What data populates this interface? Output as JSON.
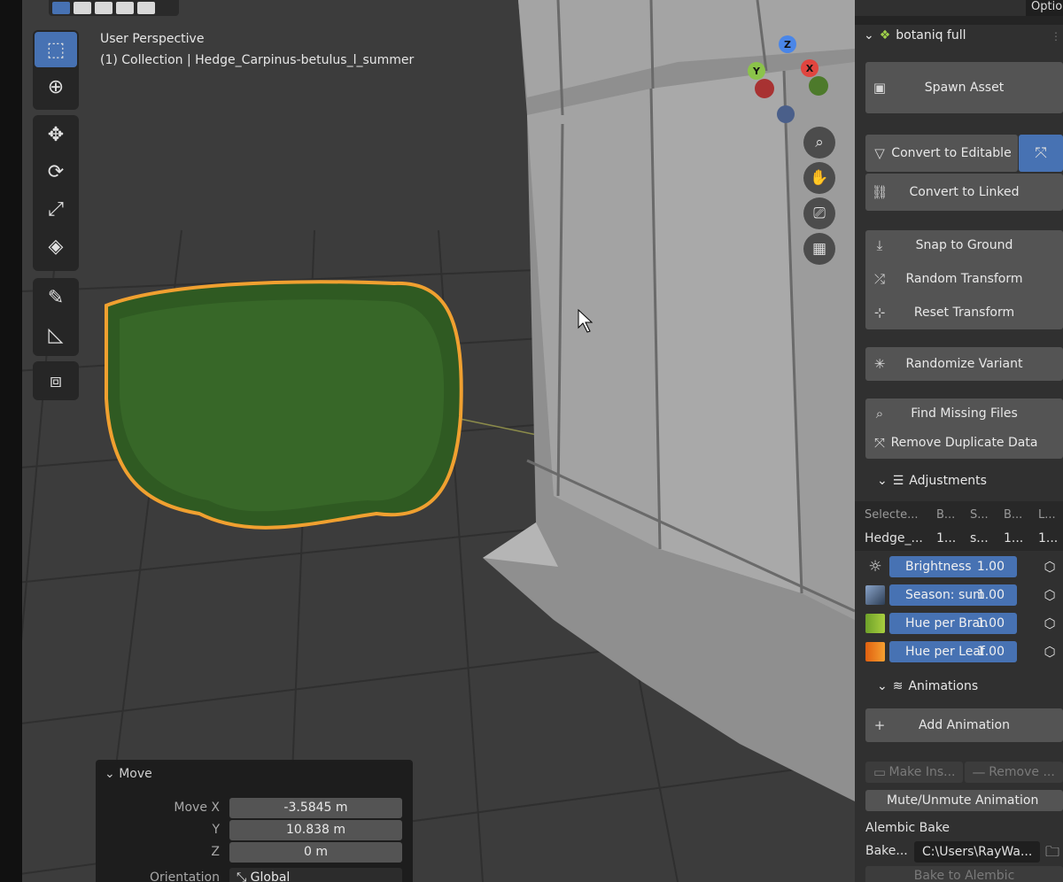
{
  "viewport": {
    "title": "User Perspective",
    "subtitle": "(1) Collection | Hedge_Carpinus-betulus_l_summer",
    "gizmo": {
      "z": "Z",
      "y": "Y",
      "x": "X"
    }
  },
  "tools": [
    {
      "name": "select-tool",
      "icon": "cursor-arrow-icon"
    },
    {
      "name": "cursor-tool",
      "icon": "crosshair-icon"
    },
    {
      "name": "move-tool",
      "icon": "move-arrows-icon"
    },
    {
      "name": "rotate-tool",
      "icon": "rotate-icon"
    },
    {
      "name": "scale-tool",
      "icon": "scale-icon"
    },
    {
      "name": "transform-tool",
      "icon": "transform-icon"
    },
    {
      "name": "annotate-tool",
      "icon": "pencil-icon"
    },
    {
      "name": "measure-tool",
      "icon": "ruler-icon"
    },
    {
      "name": "add-cube-tool",
      "icon": "add-cube-icon"
    }
  ],
  "move_panel": {
    "title": "Move",
    "move_x_label": "Move X",
    "move_x": "-3.5845 m",
    "y_label": "Y",
    "y": "10.838 m",
    "z_label": "Z",
    "z": "0 m",
    "orientation_label": "Orientation",
    "orientation": "Global"
  },
  "sidebar": {
    "options_tab": "Options",
    "addon_title": "botaniq full",
    "spawn_asset": "Spawn Asset",
    "convert_editable": "Convert to Editable",
    "convert_linked": "Convert to Linked",
    "snap_ground": "Snap to Ground",
    "random_transform": "Random Transform",
    "reset_transform": "Reset Transform",
    "randomize_variant": "Randomize Variant",
    "find_missing": "Find Missing Files",
    "remove_duplicate": "Remove Duplicate Data",
    "adjustments": "Adjustments",
    "columns": [
      "Selecte...",
      "B...",
      "S...",
      "B...",
      "L..."
    ],
    "row": [
      "Hedge_...",
      "1...",
      "s...",
      "1...",
      "1..."
    ],
    "attributes": [
      {
        "label": "Brightness",
        "value": "1.00",
        "color": "#4772b3"
      },
      {
        "label": "Season: sum",
        "value": "1.00",
        "color": "#4a5e78"
      },
      {
        "label": "Hue per Bran",
        "value": "1.00",
        "color": "#9fc33b"
      },
      {
        "label": "Hue per Leaf",
        "value": "1.00",
        "color": "#f07a1f"
      }
    ],
    "animations": "Animations",
    "add_animation": "Add Animation",
    "make_instance": "Make Ins...",
    "remove": "Remove ...",
    "mute_unmute": "Mute/Unmute Animation",
    "alembic_bake": "Alembic Bake",
    "bake_label": "Bake...",
    "bake_path": "C:\\Users\\RayWa...",
    "bake_to_alembic": "Bake to Alembic"
  }
}
